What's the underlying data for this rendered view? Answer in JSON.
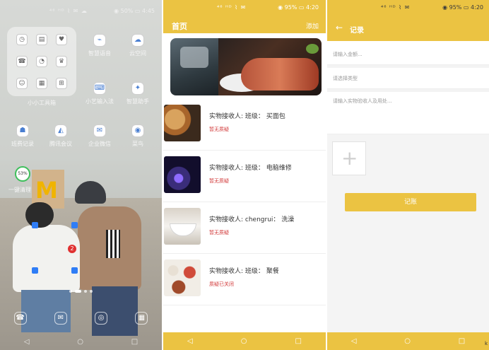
{
  "home": {
    "status": {
      "signal": "⁴⁶ ᴴᴰ ⌇ ✉ ☁",
      "battery_time": "◉ 50% ▭ 4:45"
    },
    "folder": {
      "label": "小小工具箱",
      "mini_icons": [
        "◷",
        "▤",
        "♥",
        "☎",
        "◔",
        "♛",
        "☺",
        "▦",
        "⊞"
      ]
    },
    "apps": [
      {
        "label": "智慧语音",
        "icon": "⌁"
      },
      {
        "label": "云空间",
        "icon": "☁"
      },
      {
        "label": "小艺输入法",
        "icon": "⌨"
      },
      {
        "label": "智慧助手",
        "icon": "✦"
      },
      {
        "label": "班费记录",
        "icon": "☗"
      },
      {
        "label": "腾讯会议",
        "icon": "◭"
      },
      {
        "label": "企业微信",
        "icon": "✉"
      },
      {
        "label": "菜鸟",
        "icon": "◉"
      }
    ],
    "cleaner": {
      "percent": "53%",
      "label": "一键清理"
    },
    "badge_count": "2",
    "dock": [
      "☎",
      "✉",
      "◎",
      "▦"
    ],
    "nav": [
      "◁",
      "○",
      "□"
    ]
  },
  "list_page": {
    "status": {
      "signal": "⁴⁶ ᴴᴰ ⌇ ✉",
      "battery_time": "◉ 95% ▭ 4:20"
    },
    "title": "首页",
    "add_label": "添加",
    "items": [
      {
        "title": "实物接收人: 班级：  买面包",
        "status": "暂无质疑"
      },
      {
        "title": "实物接收人: 班级：  电脑维修",
        "status": "暂无质疑"
      },
      {
        "title": "实物接收人: chengrui：  洗澡",
        "status": "暂无质疑"
      },
      {
        "title": "实物接收人: 班级：  聚餐",
        "status": "质疑已关闭"
      }
    ],
    "nav": [
      "◁",
      "○",
      "□"
    ]
  },
  "record_page": {
    "status": {
      "signal": "⁴⁶ ᴴᴰ ⌇ ✉",
      "battery_time": "◉ 95% ▭ 4:20"
    },
    "back_icon": "←",
    "title": "记录",
    "amount_placeholder": "请输入金额...",
    "type_placeholder": "请选择类型",
    "note_placeholder": "请输入实物验收人及用处...",
    "upload_icon": "+",
    "submit_label": "记账",
    "nav": [
      "◁",
      "○",
      "□"
    ]
  },
  "corner_text": "k"
}
